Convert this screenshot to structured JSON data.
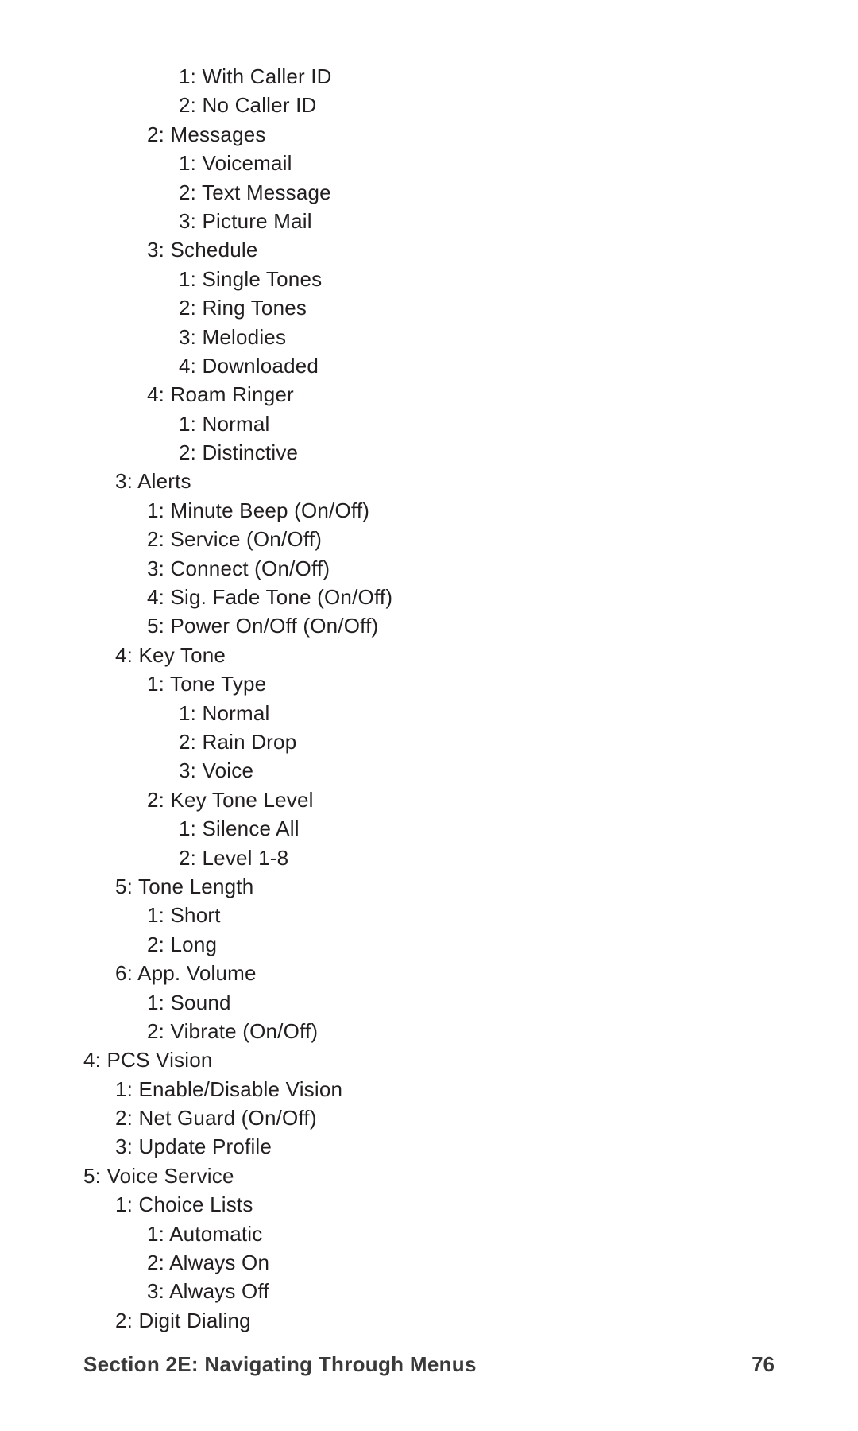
{
  "footer": {
    "section": "Section 2E: Navigating Through Menus",
    "page": "76"
  },
  "lines": [
    {
      "indent": 3,
      "text": "1: With Caller ID"
    },
    {
      "indent": 3,
      "text": "2: No Caller ID"
    },
    {
      "indent": 2,
      "text": "2: Messages"
    },
    {
      "indent": 3,
      "text": "1: Voicemail"
    },
    {
      "indent": 3,
      "text": "2: Text Message"
    },
    {
      "indent": 3,
      "text": "3: Picture Mail"
    },
    {
      "indent": 2,
      "text": "3: Schedule"
    },
    {
      "indent": 3,
      "text": "1: Single Tones"
    },
    {
      "indent": 3,
      "text": "2: Ring Tones"
    },
    {
      "indent": 3,
      "text": "3: Melodies"
    },
    {
      "indent": 3,
      "text": "4: Downloaded"
    },
    {
      "indent": 2,
      "text": "4: Roam Ringer"
    },
    {
      "indent": 3,
      "text": "1: Normal"
    },
    {
      "indent": 3,
      "text": "2: Distinctive"
    },
    {
      "indent": 1,
      "text": "3: Alerts"
    },
    {
      "indent": 2,
      "text": "1: Minute Beep (On/Off)"
    },
    {
      "indent": 2,
      "text": "2: Service (On/Off)"
    },
    {
      "indent": 2,
      "text": "3: Connect (On/Off)"
    },
    {
      "indent": 2,
      "text": "4: Sig. Fade Tone (On/Off)"
    },
    {
      "indent": 2,
      "text": "5: Power On/Off (On/Off)"
    },
    {
      "indent": 1,
      "text": "4: Key Tone"
    },
    {
      "indent": 2,
      "text": "1: Tone Type"
    },
    {
      "indent": 3,
      "text": "1: Normal"
    },
    {
      "indent": 3,
      "text": "2: Rain Drop"
    },
    {
      "indent": 3,
      "text": "3: Voice"
    },
    {
      "indent": 2,
      "text": "2: Key Tone Level"
    },
    {
      "indent": 3,
      "text": "1: Silence All"
    },
    {
      "indent": 3,
      "text": "2: Level 1-8"
    },
    {
      "indent": 1,
      "text": "5: Tone Length"
    },
    {
      "indent": 2,
      "text": "1: Short"
    },
    {
      "indent": 2,
      "text": "2: Long"
    },
    {
      "indent": 1,
      "text": "6: App. Volume"
    },
    {
      "indent": 2,
      "text": "1: Sound"
    },
    {
      "indent": 2,
      "text": "2: Vibrate (On/Off)"
    },
    {
      "indent": 0,
      "text": "4: PCS Vision"
    },
    {
      "indent": 1,
      "text": "1: Enable/Disable Vision"
    },
    {
      "indent": 1,
      "text": "2: Net Guard (On/Off)"
    },
    {
      "indent": 1,
      "text": "3: Update Profile"
    },
    {
      "indent": 0,
      "text": "5: Voice Service"
    },
    {
      "indent": 1,
      "text": "1: Choice Lists"
    },
    {
      "indent": 2,
      "text": "1: Automatic"
    },
    {
      "indent": 2,
      "text": "2: Always On"
    },
    {
      "indent": 2,
      "text": "3: Always Off"
    },
    {
      "indent": 1,
      "text": "2: Digit Dialing"
    }
  ]
}
